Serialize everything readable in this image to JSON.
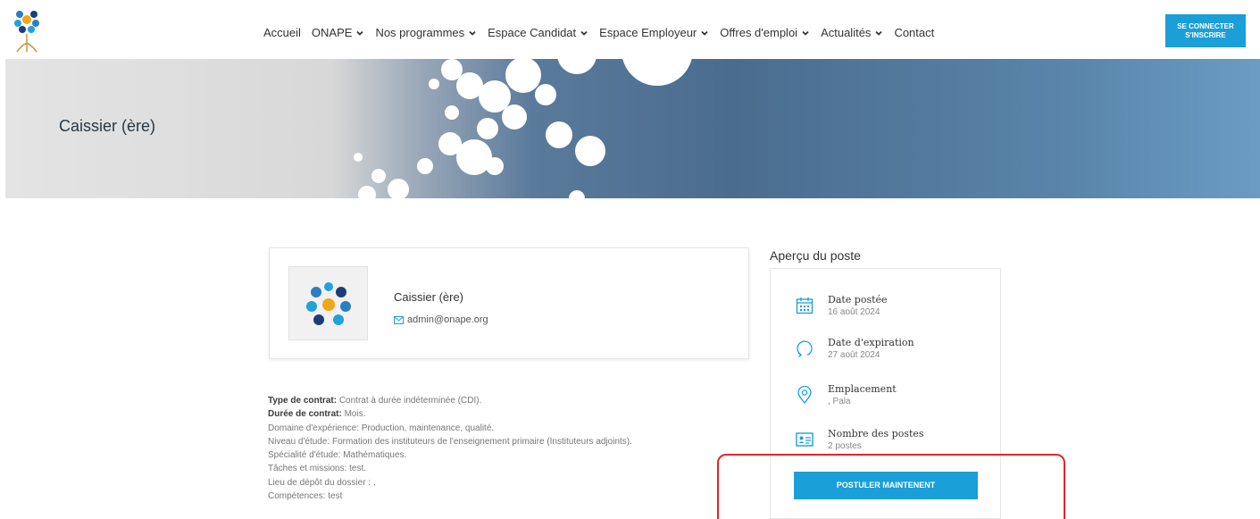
{
  "header": {
    "nav": [
      {
        "label": "Accueil",
        "dropdown": false
      },
      {
        "label": "ONAPE",
        "dropdown": true
      },
      {
        "label": "Nos programmes",
        "dropdown": true
      },
      {
        "label": "Espace Candidat",
        "dropdown": true
      },
      {
        "label": "Espace Employeur",
        "dropdown": true
      },
      {
        "label": "Offres d'emploi",
        "dropdown": true
      },
      {
        "label": "Actualités",
        "dropdown": true
      },
      {
        "label": "Contact",
        "dropdown": false
      }
    ],
    "login_line1": "SE CONNECTER",
    "login_line2": "S'INSCRIRE"
  },
  "banner": {
    "title": "Caissier (ère)"
  },
  "job": {
    "title": "Caissier (ère)",
    "email": "admin@onape.org"
  },
  "description": {
    "contract_type_label": "Type de contrat:",
    "contract_type_value": " Contrat à durée indéterminée (CDI).",
    "contract_duration_label": "Durée de contrat:",
    "contract_duration_value": " Mois.",
    "lines": [
      "Domaine d'expérience: Production, maintenance, qualité.",
      "Niveau d'étude: Formation des instituteurs de l'enseignement primaire (Instituteurs adjoints).",
      "Spécialité d'étude: Mathématiques.",
      "Tâches et missions: test.",
      "Lieu de dépôt du dossier : ,",
      "Compétences: test"
    ]
  },
  "overview": {
    "heading": "Aperçu du poste",
    "items": [
      {
        "icon": "calendar-icon",
        "label": "Date postée",
        "value": "16 août 2024"
      },
      {
        "icon": "refresh-icon",
        "label": "Date d'expiration",
        "value": "27 août 2024"
      },
      {
        "icon": "location-pin-icon",
        "label": "Emplacement",
        "value": ", Pala"
      },
      {
        "icon": "id-card-icon",
        "label": "Nombre des postes",
        "value": "2 postes"
      }
    ],
    "apply_label": "POSTULER MAINTENENT"
  },
  "colors": {
    "accent": "#1a9fd8",
    "highlight": "#e0242c"
  }
}
